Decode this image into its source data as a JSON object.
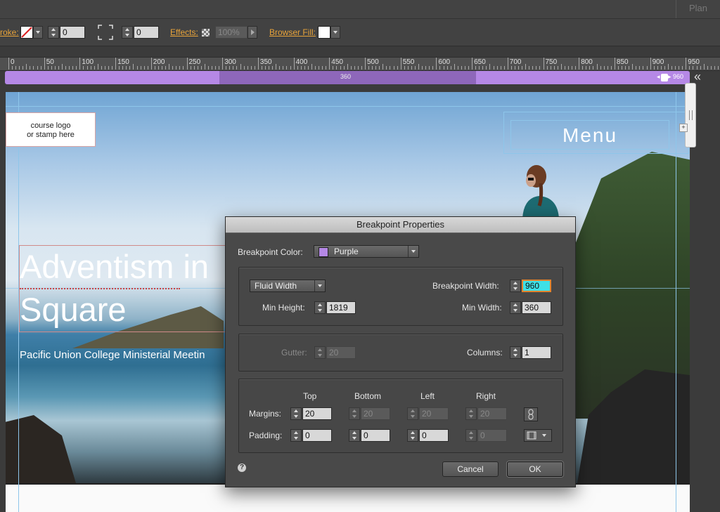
{
  "top": {
    "plan_label": "Plan"
  },
  "toolbar": {
    "stroke_label": "roke:",
    "stroke_value": "0",
    "corner_value": "0",
    "effects_label": "Effects:",
    "effects_value": "100%",
    "browser_fill_label": "Browser Fill:"
  },
  "ruler": {
    "labels": [
      "0",
      "50",
      "100",
      "150",
      "200",
      "250",
      "300",
      "350",
      "400",
      "450",
      "500",
      "550",
      "600",
      "650",
      "700",
      "750",
      "800",
      "850",
      "900",
      "950"
    ],
    "min_breakpoint": "360",
    "max_breakpoint": "960"
  },
  "canvas": {
    "logo_line1": "course logo",
    "logo_line2": "or stamp here",
    "menu_label": "Menu",
    "headline_line1": "Adventism in",
    "headline_line2": "Square",
    "subline": "Pacific Union College Ministerial Meetin"
  },
  "dialog": {
    "title": "Breakpoint Properties",
    "color_label": "Breakpoint Color:",
    "color_value": "Purple",
    "width_mode": "Fluid Width",
    "bp_width_label": "Breakpoint Width:",
    "bp_width_value": "960",
    "min_height_label": "Min Height:",
    "min_height_value": "1819",
    "min_width_label": "Min Width:",
    "min_width_value": "360",
    "gutter_label": "Gutter:",
    "gutter_value": "20",
    "columns_label": "Columns:",
    "columns_value": "1",
    "col_top": "Top",
    "col_bottom": "Bottom",
    "col_left": "Left",
    "col_right": "Right",
    "margins_label": "Margins:",
    "margins": [
      "20",
      "20",
      "20",
      "20"
    ],
    "padding_label": "Padding:",
    "padding": [
      "0",
      "0",
      "0",
      "0"
    ],
    "cancel_label": "Cancel",
    "ok_label": "OK",
    "help_icon_text": "?"
  },
  "colors": {
    "breakpoint_purple": "#b588e6",
    "accent_orange": "#e8a33a",
    "guide_blue": "#8ec6ea"
  }
}
